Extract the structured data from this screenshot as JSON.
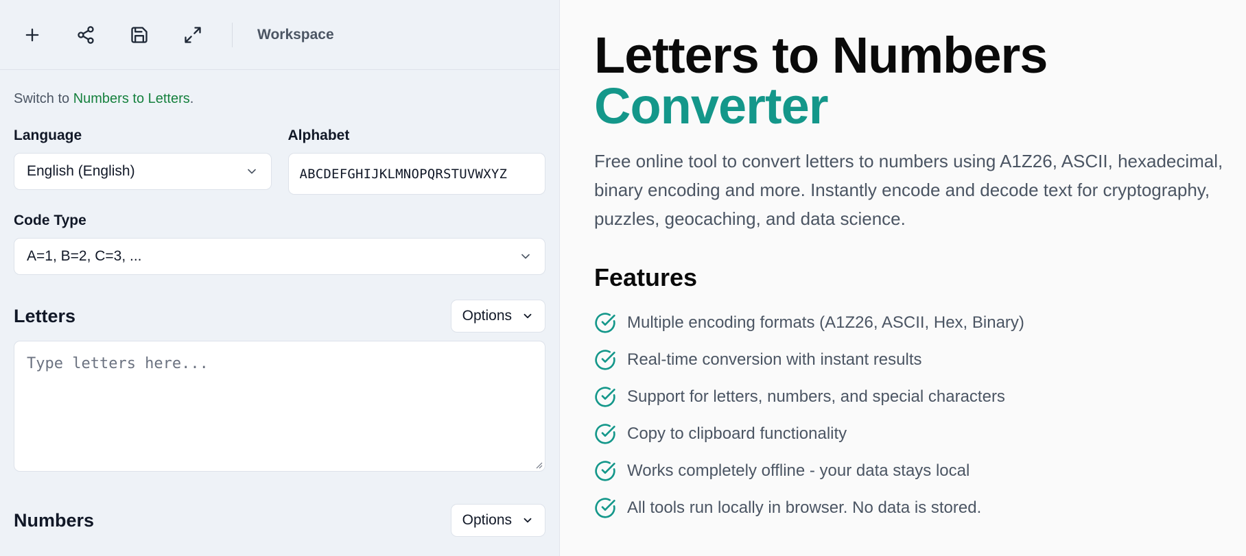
{
  "toolbar": {
    "buttons": [
      {
        "icon": "plus-icon"
      },
      {
        "icon": "share-icon"
      },
      {
        "icon": "save-icon"
      },
      {
        "icon": "expand-icon"
      }
    ],
    "workspace_label": "Workspace"
  },
  "switch": {
    "prefix": "Switch to ",
    "link": "Numbers to Letters",
    "suffix": "."
  },
  "language": {
    "label": "Language",
    "value": "English (English)"
  },
  "alphabet": {
    "label": "Alphabet",
    "value": "ABCDEFGHIJKLMNOPQRSTUVWXYZ"
  },
  "code_type": {
    "label": "Code Type",
    "value": "A=1, B=2, C=3, ..."
  },
  "letters": {
    "title": "Letters",
    "options_label": "Options",
    "placeholder": "Type letters here..."
  },
  "numbers": {
    "title": "Numbers",
    "options_label": "Options"
  },
  "hero": {
    "title_line1": "Letters to Numbers",
    "title_line2": "Converter",
    "description": "Free online tool to convert letters to numbers using A1Z26, ASCII, hexadecimal, binary encoding and more. Instantly encode and decode text for cryptography, puzzles, geocaching, and data science."
  },
  "features": {
    "title": "Features",
    "items": [
      "Multiple encoding formats (A1Z26, ASCII, Hex, Binary)",
      "Real-time conversion with instant results",
      "Support for letters, numbers, and special characters",
      "Copy to clipboard functionality",
      "Works completely offline - your data stays local",
      "All tools run locally in browser. No data is stored."
    ]
  },
  "colors": {
    "accent": "#14978a",
    "link": "#15803d",
    "panel_bg": "#eef2f7"
  }
}
